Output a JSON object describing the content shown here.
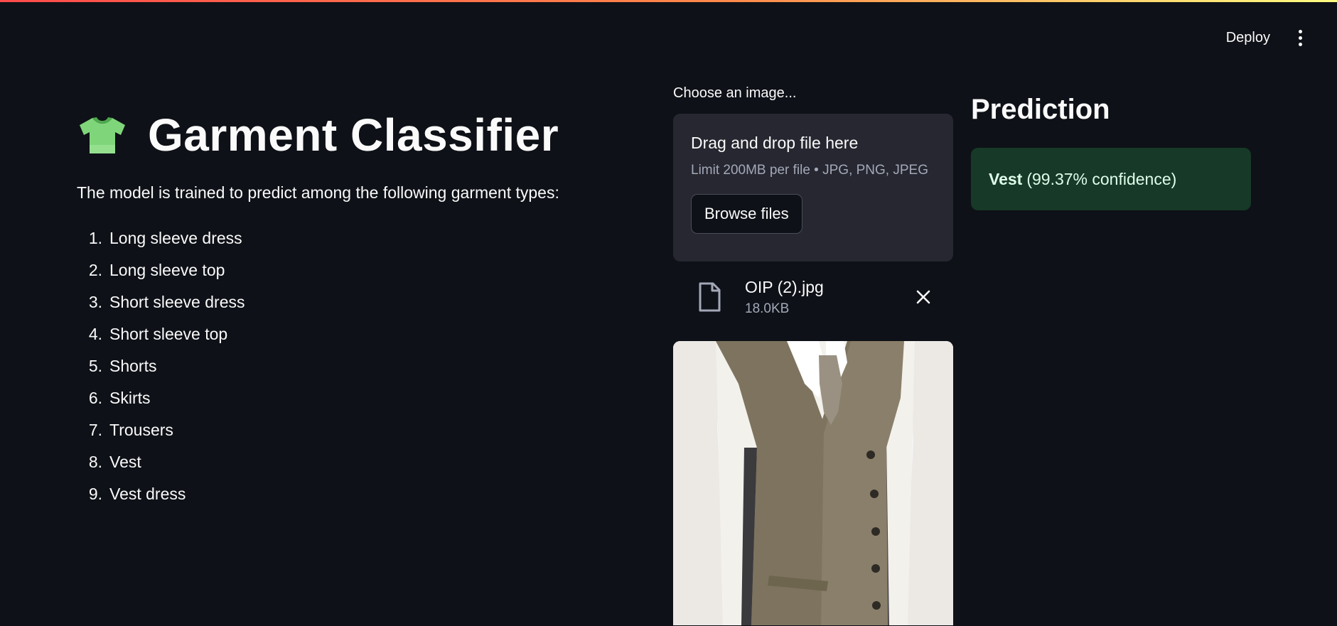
{
  "header": {
    "deploy_label": "Deploy",
    "menu_icon": "kebab-menu-icon"
  },
  "main": {
    "title": "Garment Classifier",
    "title_icon": "t-shirt-icon",
    "description": "The model is trained to predict among the following garment types:",
    "garment_types": [
      {
        "num": "1.",
        "label": "Long sleeve dress"
      },
      {
        "num": "2.",
        "label": "Long sleeve top"
      },
      {
        "num": "3.",
        "label": "Short sleeve dress"
      },
      {
        "num": "4.",
        "label": "Short sleeve top"
      },
      {
        "num": "5.",
        "label": "Shorts"
      },
      {
        "num": "6.",
        "label": "Skirts"
      },
      {
        "num": "7.",
        "label": "Trousers"
      },
      {
        "num": "8.",
        "label": "Vest"
      },
      {
        "num": "9.",
        "label": "Vest dress"
      }
    ]
  },
  "uploader": {
    "label": "Choose an image...",
    "drop_title": "Drag and drop file here",
    "limit_text": "Limit 200MB per file • JPG, PNG, JPEG",
    "browse_label": "Browse files",
    "file": {
      "name": "OIP (2).jpg",
      "size": "18.0KB",
      "icon": "file-icon",
      "remove_icon": "close-icon"
    }
  },
  "prediction": {
    "heading": "Prediction",
    "label": "Vest",
    "confidence_text": "(99.37% confidence)"
  },
  "colors": {
    "background": "#0e1117",
    "card": "#262730",
    "success_bg": "#173928",
    "success_text": "#dffde9"
  }
}
